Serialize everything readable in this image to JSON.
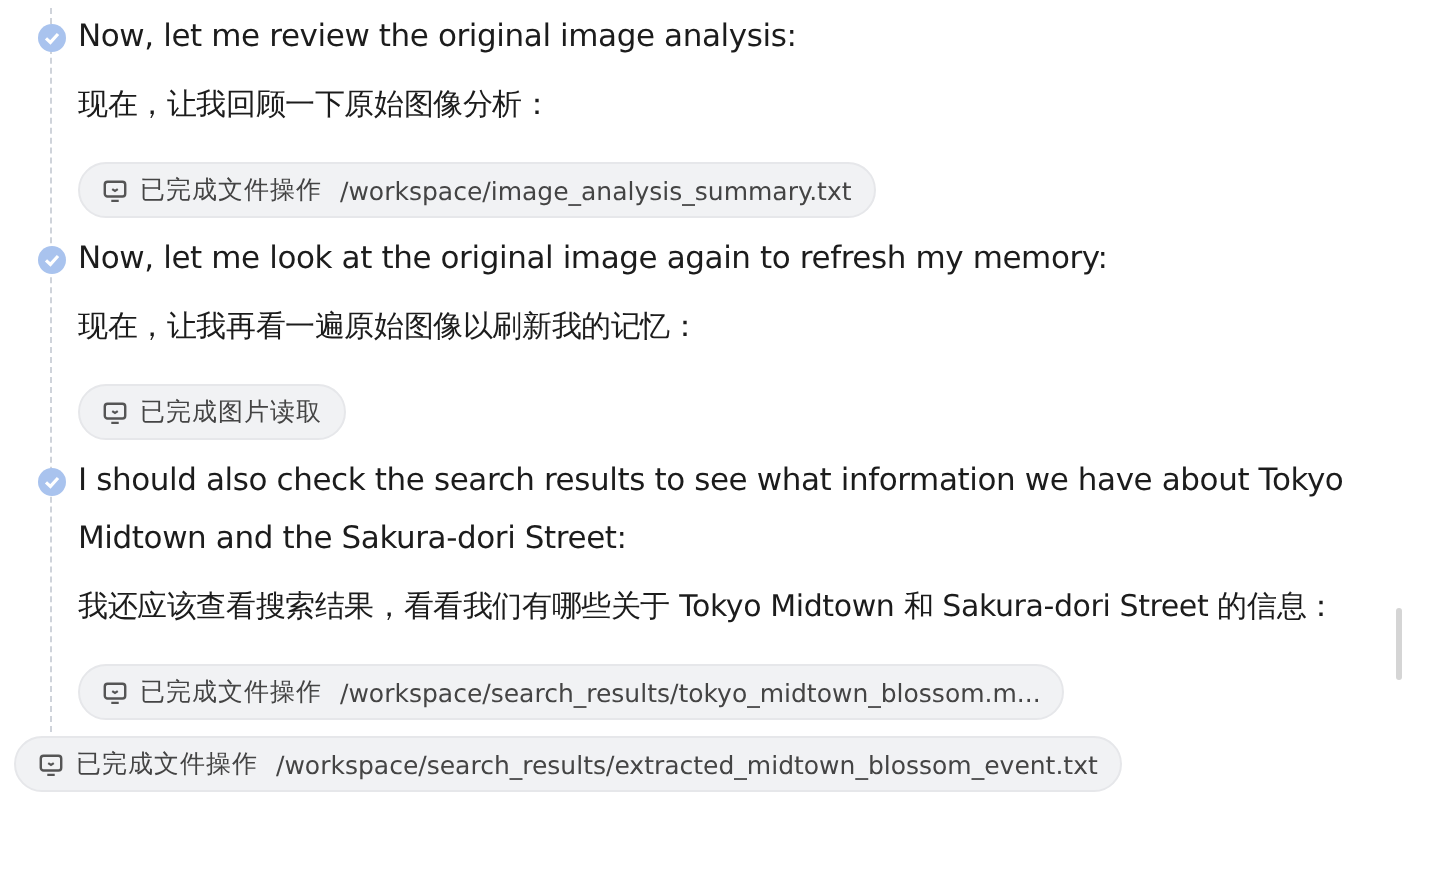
{
  "steps": [
    {
      "title": "Now, let me review the original image analysis:",
      "translation": "现在，让我回顾一下原始图像分析：",
      "actions": [
        {
          "status": "已完成文件操作",
          "detail": "/workspace/image_analysis_summary.txt"
        }
      ]
    },
    {
      "title": "Now, let me look at the original image again to refresh my memory:",
      "translation": "现在，让我再看一遍原始图像以刷新我的记忆：",
      "actions": [
        {
          "status": "已完成图片读取"
        }
      ]
    },
    {
      "title": "I should also check the search results to see what information we have about Tokyo Midtown and the Sakura-dori Street:",
      "translation": "我还应该查看搜索结果，看看我们有哪些关于 Tokyo Midtown 和 Sakura-dori Street 的信息：",
      "actions": [
        {
          "status": "已完成文件操作",
          "detail": "/workspace/search_results/tokyo_midtown_blossom.m..."
        }
      ]
    }
  ],
  "floating_action": {
    "status": "已完成文件操作",
    "detail": "/workspace/search_results/extracted_midtown_blossom_event.txt"
  }
}
